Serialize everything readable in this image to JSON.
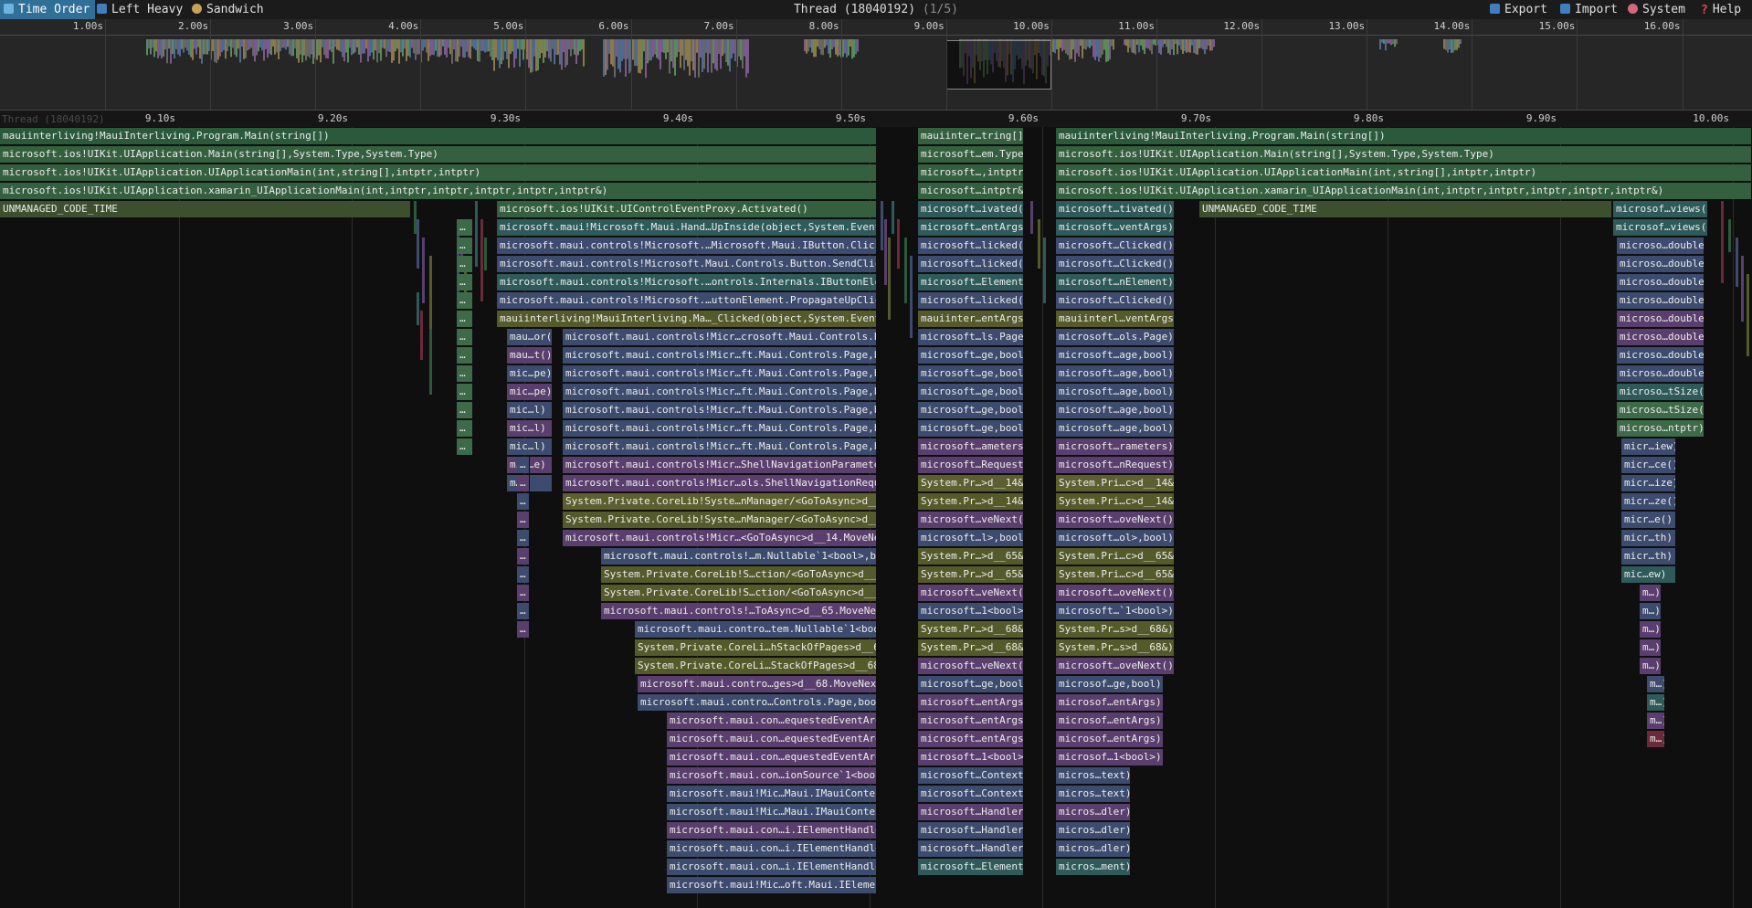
{
  "toolbar": {
    "time_order": "Time Order",
    "left_heavy": "Left Heavy",
    "sandwich": "Sandwich",
    "title": "Thread (18040192)",
    "title_sub": "(1/5)",
    "export": "Export",
    "import": "Import",
    "system": "System",
    "help": "Help"
  },
  "overview_ticks": [
    "1.00s",
    "2.00s",
    "3.00s",
    "4.00s",
    "5.00s",
    "6.00s",
    "7.00s",
    "8.00s",
    "9.00s",
    "10.00s",
    "11.00s",
    "12.00s",
    "13.00s",
    "14.00s",
    "15.00s",
    "16.00s"
  ],
  "flame_ticks": [
    "9.10s",
    "9.20s",
    "9.30s",
    "9.40s",
    "9.50s",
    "9.60s",
    "9.70s",
    "9.80s",
    "9.90s",
    "10.00s"
  ],
  "flame_thread_label": "Thread (18040192)",
  "frames_left": [
    "mauiinterliving!MauiInterliving.Program.Main(string[])",
    "microsoft.ios!UIKit.UIApplication.Main(string[],System.Type,System.Type)",
    "microsoft.ios!UIKit.UIApplication.UIApplicationMain(int,string[],intptr,intptr)",
    "microsoft.ios!UIKit.UIApplication.xamarin_UIApplicationMain(int,intptr,intptr,intptr,intptr,intptr&)",
    "UNMANAGED_CODE_TIME"
  ],
  "frames_right": [
    "mauiinterliving!MauiInterliving.Program.Main(string[])",
    "microsoft.ios!UIKit.UIApplication.Main(string[],System.Type,System.Type)",
    "microsoft.ios!UIKit.UIApplication.UIApplicationMain(int,string[],intptr,intptr)",
    "microsoft.ios!UIKit.UIApplication.xamarin_UIApplicationMain(int,intptr,intptr,intptr,intptr,intptr&)",
    "UNMANAGED_CODE_TIME"
  ],
  "stack_a": [
    "microsoft.ios!UIKit.UIControlEventProxy.Activated()",
    "microsoft.maui!Microsoft.Maui.Hand…UpInside(object,System.EventArgs)",
    "microsoft.maui.controls!Microsoft.…Microsoft.Maui.IButton.Clicked()",
    "microsoft.maui.controls!Microsoft.Maui.Controls.Button.SendClicked()",
    "microsoft.maui.controls!Microsoft.…ontrols.Internals.IButtonElement)",
    "microsoft.maui.controls!Microsoft.…uttonElement.PropagateUpClicked()",
    "mauiinterliving!MauiInterliving.Ma…_Clicked(object,System.EventArgs)"
  ],
  "stack_a2": [
    "microsoft.maui.controls!Micr…crosoft.Maui.Controls.Page)",
    "microsoft.maui.controls!Micr…ft.Maui.Controls.Page,bool)",
    "microsoft.maui.controls!Micr…ft.Maui.Controls.Page,bool)",
    "microsoft.maui.controls!Micr…ft.Maui.Controls.Page,bool)",
    "microsoft.maui.controls!Micr…ft.Maui.Controls.Page,bool)",
    "microsoft.maui.controls!Micr…ft.Maui.Controls.Page,bool)",
    "microsoft.maui.controls!Micr…ft.Maui.Controls.Page,bool)",
    "microsoft.maui.controls!Micr…ShellNavigationParameters)",
    "microsoft.maui.controls!Micr…ols.ShellNavigationRequest)",
    "System.Private.CoreLib!Syste…nManager/<GoToAsync>d__14&)",
    "System.Private.CoreLib!Syste…nManager/<GoToAsync>d__14&)",
    "microsoft.maui.controls!Micr…<GoToAsync>d__14.MoveNext()"
  ],
  "stack_a3": [
    "microsoft.maui.controls!…m.Nullable`1<bool>,bool)",
    "System.Private.CoreLib!S…ction/<GoToAsync>d__65&)",
    "System.Private.CoreLib!S…ction/<GoToAsync>d__65&)",
    "microsoft.maui.controls!…ToAsync>d__65.MoveNext()",
    "microsoft.maui.contro…tem.Nullable`1<bool>)",
    "System.Private.CoreLi…hStackOfPages>d__68&)",
    "System.Private.CoreLi…StackOfPages>d__68&)",
    "microsoft.maui.contro…ges>d__68.MoveNext()",
    "microsoft.maui.contro…Controls.Page,bool)"
  ],
  "stack_a4": [
    "microsoft.maui.con…equestedEventArgs)",
    "microsoft.maui.con…equestedEventArgs)",
    "microsoft.maui.con…equestedEventArgs)",
    "microsoft.maui.con…ionSource`1<bool>)",
    "microsoft.maui!Mic…Maui.IMauiContext)",
    "microsoft.maui!Mic…Maui.IMauiContext)",
    "microsoft.maui.con…i.IElementHandler)",
    "microsoft.maui.con…i.IElementHandler)",
    "microsoft.maui.con…i.IElementHandler)",
    "microsoft.maui!Mic…oft.Maui.IElement)"
  ],
  "stack_b_top": [
    "mauiinter…tring[])",
    "microsoft…em.Type)",
    "microsoft…,intptr)",
    "microsoft…intptr&)"
  ],
  "stack_b": [
    "microsoft…ivated()",
    "microsoft…entArgs)",
    "microsoft…licked()",
    "microsoft…licked()",
    "microsoft…Element)",
    "microsoft…licked()",
    "mauiinter…entArgs)",
    "microsoft…ls.Page)",
    "microsoft…ge,bool)",
    "microsoft…ge,bool)",
    "microsoft…ge,bool)",
    "microsoft…ge,bool)",
    "microsoft…ge,bool)",
    "microsoft…ameters)",
    "microsoft…Request)",
    "System.Pr…>d__14&)",
    "System.Pr…>d__14&)",
    "microsoft…veNext()",
    "microsoft…l>,bool)",
    "System.Pr…>d__65&)",
    "System.Pr…>d__65&)",
    "microsoft…veNext()",
    "microsoft…1<bool>)",
    "System.Pr…>d__68&)",
    "System.Pr…>d__68&)",
    "microsoft…veNext()",
    "microsoft…ge,bool)",
    "microsoft…entArgs)",
    "microsoft…entArgs)",
    "microsoft…entArgs)",
    "microsoft…1<bool>)",
    "microsoft…Context)",
    "microsoft…Context)",
    "microsoft…Handler)",
    "microsoft…Handler)",
    "microsoft…Handler)",
    "microsoft…Element)"
  ],
  "stack_c": [
    "microsoft…tivated()",
    "microsoft…ventArgs)",
    "microsoft…Clicked()",
    "microsoft…Clicked()",
    "microsoft…nElement)",
    "microsoft…Clicked()",
    "mauiinterl…ventArgs)",
    "microsoft…ols.Page)",
    "microsoft…age,bool)",
    "microsoft…age,bool)",
    "microsoft…age,bool)",
    "microsoft…age,bool)",
    "microsoft…age,bool)",
    "microsoft…rameters)",
    "microsoft…nRequest)",
    "System.Pri…c>d__14&)",
    "System.Pri…c>d__14&)",
    "microsoft…oveNext()",
    "microsoft…ol>,bool)",
    "System.Pri…c>d__65&)",
    "System.Pri…c>d__65&)",
    "microsoft…oveNext()",
    "microsoft…`1<bool>)",
    "System.Pr…s>d__68&)",
    "System.Pr…s>d__68&)",
    "microsoft…oveNext()",
    "microsof…ge,bool)",
    "microsof…entArgs)",
    "microsof…entArgs)",
    "microsof…entArgs)",
    "microsof…1<bool>)",
    "micros…text)",
    "micros…text)",
    "micros…dler)",
    "micros…dler)",
    "micros…dler)",
    "micros…ment)"
  ],
  "stack_d": [
    "microsof…views()",
    "microsof…views()",
    "microso…double)",
    "microso…double)",
    "microso…double)",
    "microso…double)",
    "microso…double)",
    "microso…double)",
    "microso…double)",
    "microso…double)",
    "microso…tSize()",
    "microso…tSize()",
    "microso…ntptr)",
    "micr…iew)",
    "micr…ce()",
    "micr…ize)",
    "micr…ze()",
    "micr…e()",
    "micr…th)",
    "micr…th)",
    "mic…ew)",
    "m…)",
    "m…)",
    "m…)",
    "m…)",
    "m…)",
    "m…)",
    "m…)",
    "m…)",
    "m…)"
  ],
  "stack_small": [
    "mau…or()",
    "mau…t()",
    "mic…pe)",
    "mic…pe)",
    "mic…l)",
    "mic…l)",
    "mic…l)",
    "mic…e)",
    "m…)"
  ]
}
